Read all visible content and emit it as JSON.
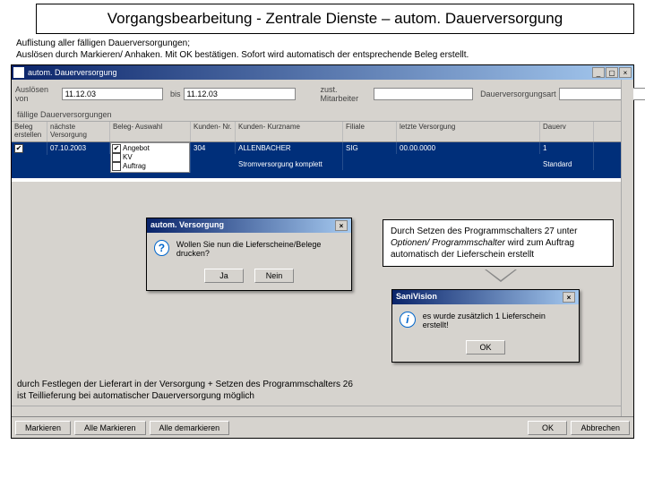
{
  "page": {
    "title": "Vorgangsbearbeitung - Zentrale Dienste – autom. Dauerversorgung",
    "desc1": "Auflistung aller fälligen Dauerversorgungen;",
    "desc2": "Auslösen durch Markieren/ Anhaken. Mit OK bestätigen. Sofort wird automatisch der entsprechende Beleg erstellt."
  },
  "window": {
    "title": "autom. Dauerversorgung"
  },
  "filters": {
    "from_label": "Auslösen von",
    "from_value": "11.12.03",
    "to_label": "bis",
    "to_value": "11.12.03",
    "mit_label": "zust. Mitarbeiter",
    "mit_value": "",
    "dart_label": "Dauerversorgungsart",
    "dart_value": ""
  },
  "grid": {
    "section": "fällige Dauerversorgungen",
    "headers": {
      "c1": "Beleg\nerstellen",
      "c2": "nächste\nVersorgung",
      "c3": "Beleg-\nAuswahl",
      "c4": "Kunden-\nNr.",
      "c5": "Kunden-\nKurzname",
      "c6": "Filiale",
      "c7": "letzte\nVersorgung",
      "c8": "Dauerv"
    },
    "row": {
      "checked": "✔",
      "next": "07.10.2003",
      "options": [
        "Angebot",
        "KV",
        "Auftrag"
      ],
      "kunde_nr": "304",
      "kunde_name": "ALLENBACHER",
      "filiale": "SIG",
      "letzte": "00.00.0000",
      "dauerv": "1",
      "desc": "Stromversorgung komplett",
      "art": "Standard"
    }
  },
  "dialog1": {
    "title": "autom. Versorgung",
    "text": "Wollen Sie nun die Lieferscheine/Belege drucken?",
    "yes": "Ja",
    "no": "Nein"
  },
  "note": {
    "l1": "Durch Setzen des Programmschalters 27 unter ",
    "i1": "Optionen/ Programmschalter",
    "l2": " wird zum Auftrag automatisch der Lieferschein erstellt"
  },
  "dialog2": {
    "title": "SaniVision",
    "text": "es wurde zusätzlich 1 Lieferschein erstellt!",
    "ok": "OK"
  },
  "bottom_note": {
    "l1": "durch Festlegen der Lieferart in der Versorgung + Setzen des Programmschalters 26",
    "l2": "ist Teillieferung bei automatischer Dauerversorgung möglich"
  },
  "footer": {
    "b1": "Markieren",
    "b2": "Alle Markieren",
    "b3": "Alle demarkieren",
    "ok": "OK",
    "cancel": "Abbrechen"
  }
}
